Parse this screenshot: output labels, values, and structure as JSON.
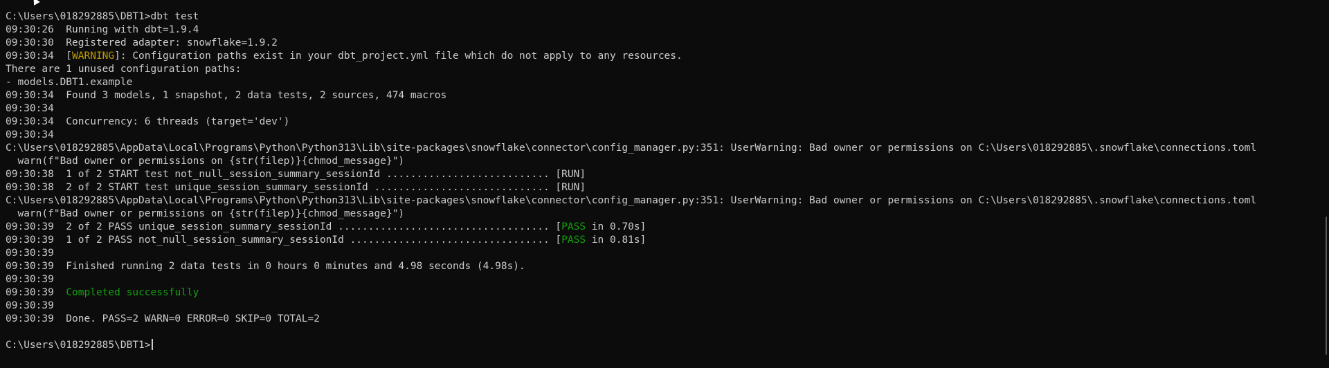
{
  "terminal": {
    "prompt": "C:\\Users\\018292885\\DBT1>",
    "command": "dbt test",
    "lines": {
      "l1": "09:30:26  Running with dbt=1.9.4",
      "l2": "09:30:30  Registered adapter: snowflake=1.9.2",
      "l3_pre": "09:30:34  [",
      "l3_warn": "WARNING",
      "l3_post": "]: Configuration paths exist in your dbt_project.yml file which do not apply to any resources.",
      "l4": "There are 1 unused configuration paths:",
      "l5": "- models.DBT1.example",
      "l6": "09:30:34  Found 3 models, 1 snapshot, 2 data tests, 2 sources, 474 macros",
      "l7": "09:30:34",
      "l8": "09:30:34  Concurrency: 6 threads (target='dev')",
      "l9": "09:30:34",
      "l10": "C:\\Users\\018292885\\AppData\\Local\\Programs\\Python\\Python313\\Lib\\site-packages\\snowflake\\connector\\config_manager.py:351: UserWarning: Bad owner or permissions on C:\\Users\\018292885\\.snowflake\\connections.toml",
      "l11": "  warn(f\"Bad owner or permissions on {str(filep)}{chmod_message}\")",
      "l12": "09:30:38  1 of 2 START test not_null_session_summary_sessionId ........................... [RUN]",
      "l13": "09:30:38  2 of 2 START test unique_session_summary_sessionId ............................. [RUN]",
      "l14": "C:\\Users\\018292885\\AppData\\Local\\Programs\\Python\\Python313\\Lib\\site-packages\\snowflake\\connector\\config_manager.py:351: UserWarning: Bad owner or permissions on C:\\Users\\018292885\\.snowflake\\connections.toml",
      "l15": "  warn(f\"Bad owner or permissions on {str(filep)}{chmod_message}\")",
      "l16_pre": "09:30:39  2 of 2 PASS unique_session_summary_sessionId ................................... [",
      "l16_pass": "PASS",
      "l16_post": " in 0.70s]",
      "l17_pre": "09:30:39  1 of 2 PASS not_null_session_summary_sessionId ................................. [",
      "l17_pass": "PASS",
      "l17_post": " in 0.81s]",
      "l18": "09:30:39",
      "l19": "09:30:39  Finished running 2 data tests in 0 hours 0 minutes and 4.98 seconds (4.98s).",
      "l20": "09:30:39",
      "l21_pre": "09:30:39  ",
      "l21_ok": "Completed successfully",
      "l22": "09:30:39",
      "l23": "09:30:39  Done. PASS=2 WARN=0 ERROR=0 SKIP=0 TOTAL=2"
    }
  },
  "colors": {
    "background": "#0c0c0c",
    "text": "#cccccc",
    "warning": "#c19c00",
    "success": "#13a10e"
  }
}
